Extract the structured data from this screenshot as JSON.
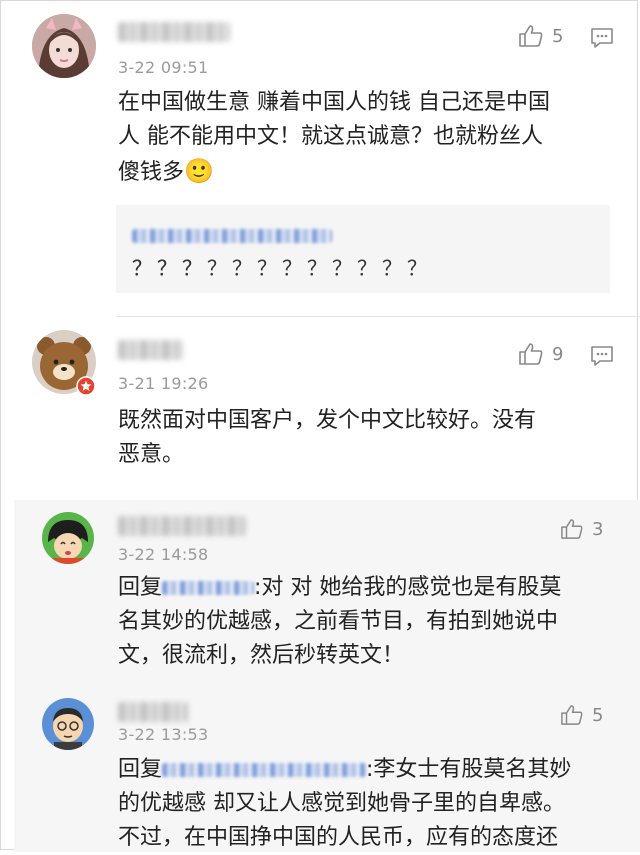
{
  "comments": [
    {
      "time": "3-22 09:51",
      "likes": "5",
      "text_lines": [
        "在中国做生意 赚着中国人的钱 自己还是中国",
        "人 能不能用中文！就这点诚意？也就粉丝人",
        "傻钱多"
      ],
      "emoji": "🙂",
      "quote_line1_tail": "？？？？？？？？？？？？",
      "quote_line2": "？？？"
    },
    {
      "time": "3-21 19:26",
      "likes": "9",
      "text_lines": [
        "既然面对中国客户，发个中文比较好。没有",
        "恶意。"
      ]
    }
  ],
  "replies": [
    {
      "time": "3-22 14:58",
      "likes": "3",
      "prefix": "回复",
      "line1_tail": ":对 对 她给我的感觉也是有股莫",
      "lines": [
        "名其妙的优越感，之前看节目，有拍到她说中",
        "文，很流利，然后秒转英文！"
      ]
    },
    {
      "time": "3-22 13:53",
      "likes": "5",
      "prefix": "回复",
      "line1_tail": ":李女士有股莫名其妙",
      "lines": [
        "的优越感 却又让人感觉到她骨子里的自卑感。",
        "不过，在中国挣中国的人民币，应有的态度还"
      ]
    }
  ],
  "icons": {
    "like": "thumbs-up-icon",
    "comment": "comment-bubble-icon",
    "badge": "star-badge-icon"
  },
  "colors": {
    "link": "#5b7fc7",
    "meta": "#9a9a9a",
    "reply_bg": "#f6f6f6",
    "quote_bg": "#f5f5f5"
  }
}
